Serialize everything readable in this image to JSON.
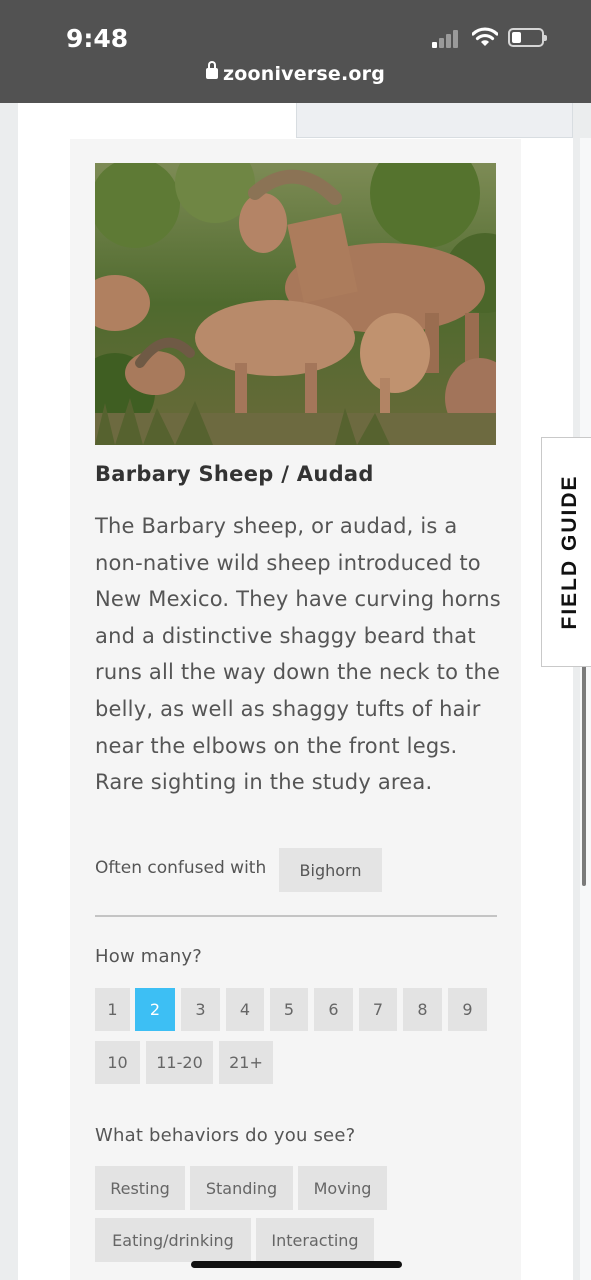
{
  "status_bar": {
    "time": "9:48",
    "url": "zooniverse.org"
  },
  "field_guide": {
    "tab_label": "FIELD GUIDE"
  },
  "species": {
    "name": "Barbary Sheep / Audad",
    "description": "The Barbary sheep, or audad, is a non-native wild sheep introduced to New Mexico. They have curving horns and a distinctive shaggy beard that runs all the way down the neck to the belly, as well as shaggy tufts of hair near the elbows on the front legs. Rare sighting in the study area.",
    "confused_label": "Often confused with",
    "confused_with": [
      "Bighorn"
    ]
  },
  "how_many": {
    "question": "How many?",
    "options": [
      "1",
      "2",
      "3",
      "4",
      "5",
      "6",
      "7",
      "8",
      "9",
      "10",
      "11-20",
      "21+"
    ],
    "selected": "2"
  },
  "behaviors": {
    "question": "What behaviors do you see?",
    "options": [
      "Resting",
      "Standing",
      "Moving",
      "Eating/drinking",
      "Interacting"
    ]
  },
  "colors": {
    "selected_chip": "#3dbff4",
    "status_bar_bg": "#525252",
    "chip_bg": "#e3e3e3"
  }
}
